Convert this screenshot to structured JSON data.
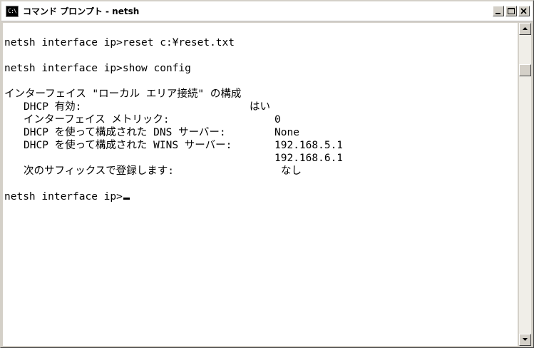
{
  "window": {
    "title": "コマンド プロンプト - netsh",
    "icon_label": "C:\\",
    "minimize_icon": "minimize-icon",
    "maximize_icon": "maximize-icon",
    "close_icon": "close-icon"
  },
  "console": {
    "cmd1": "netsh interface ip>reset c:¥reset.txt",
    "cmd2": "netsh interface ip>show config",
    "section_header": "インターフェイス \"ローカル エリア接続\" の構成",
    "dhcp_label": "DHCP 有効:",
    "dhcp_value": "はい",
    "metric_label": "インターフェイス メトリック:",
    "metric_value": "0",
    "dns_label": "DHCP を使って構成された DNS サーバー:",
    "dns_value": "None",
    "wins_label": "DHCP を使って構成された WINS サーバー:",
    "wins_value_1": "192.168.5.1",
    "wins_value_2": "192.168.6.1",
    "suffix_label": "次のサフィックスで登録します:",
    "suffix_value": "なし",
    "prompt": "netsh interface ip>"
  },
  "scrollbar": {
    "up_icon": "scroll-up-arrow-icon",
    "down_icon": "scroll-down-arrow-icon"
  }
}
